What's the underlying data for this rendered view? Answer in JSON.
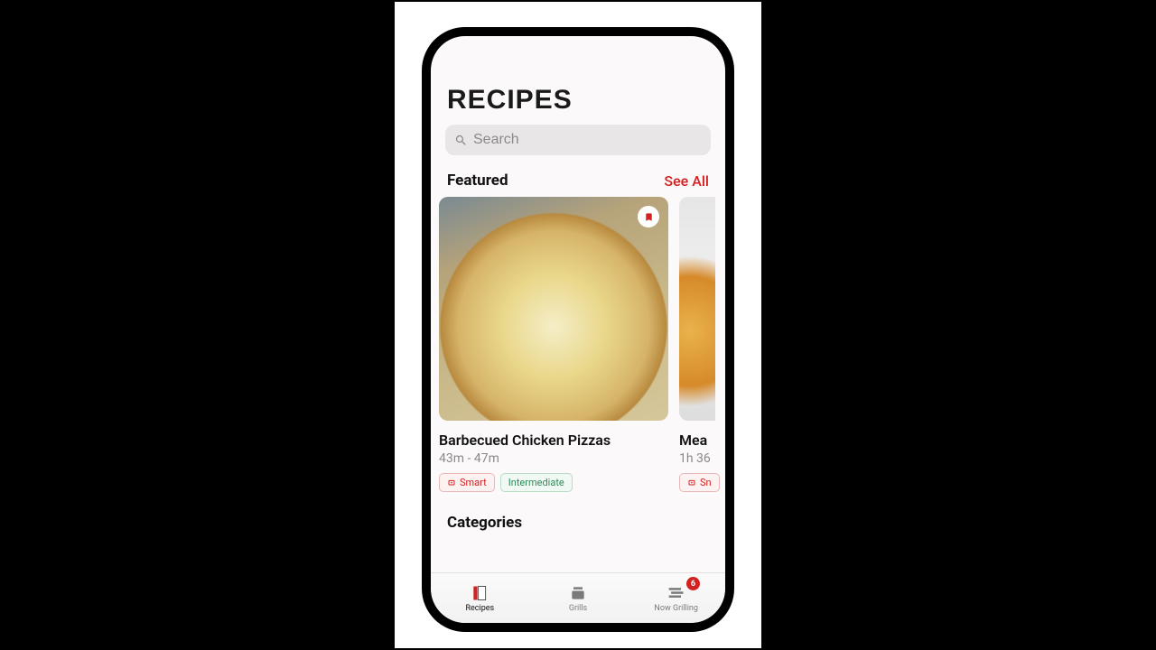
{
  "header": {
    "title": "RECIPES"
  },
  "search": {
    "placeholder": "Search"
  },
  "featured": {
    "title": "Featured",
    "see_all": "See All",
    "cards": [
      {
        "title": "Barbecued Chicken Pizzas",
        "time": "43m - 47m",
        "smart_label": "Smart",
        "level_label": "Intermediate"
      },
      {
        "title": "Mea",
        "time": "1h 36",
        "smart_label": "Sn"
      }
    ]
  },
  "categories": {
    "title": "Categories"
  },
  "tabs": {
    "recipes": "Recipes",
    "grills": "Grills",
    "now_grilling": "Now Grilling",
    "badge": "6"
  }
}
